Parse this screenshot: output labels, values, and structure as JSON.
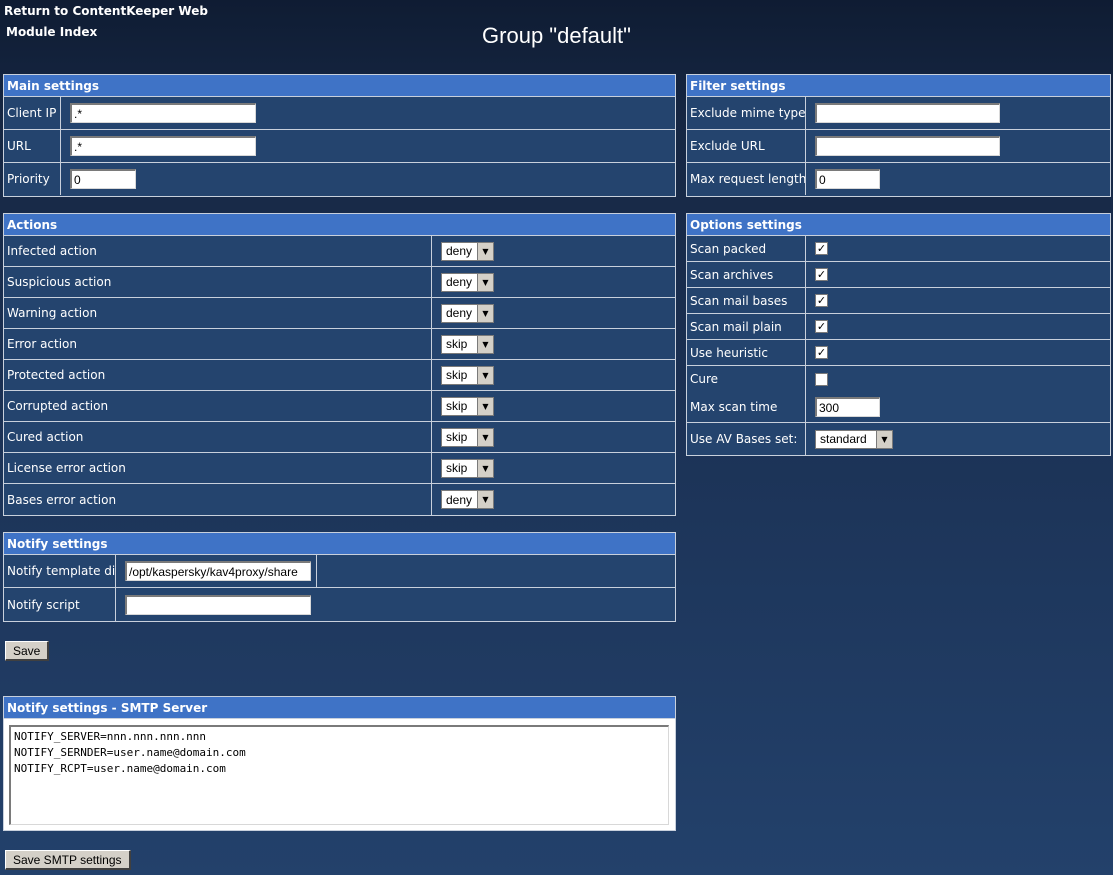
{
  "nav": {
    "return_link": "Return to ContentKeeper Web",
    "module_index": "Module Index"
  },
  "page_title": "Group \"default\"",
  "main_settings": {
    "title": "Main settings",
    "client_ip_label": "Client IP",
    "client_ip_value": ".*",
    "url_label": "URL",
    "url_value": ".*",
    "priority_label": "Priority",
    "priority_value": "0"
  },
  "filter_settings": {
    "title": "Filter settings",
    "exclude_mime_label": "Exclude mime type",
    "exclude_mime_value": "",
    "exclude_url_label": "Exclude URL",
    "exclude_url_value": "",
    "max_request_label": "Max request length",
    "max_request_value": "0"
  },
  "actions": {
    "title": "Actions",
    "items": [
      {
        "label": "Infected action",
        "value": "deny"
      },
      {
        "label": "Suspicious action",
        "value": "deny"
      },
      {
        "label": "Warning action",
        "value": "deny"
      },
      {
        "label": "Error action",
        "value": "skip"
      },
      {
        "label": "Protected action",
        "value": "skip"
      },
      {
        "label": "Corrupted action",
        "value": "skip"
      },
      {
        "label": "Cured action",
        "value": "skip"
      },
      {
        "label": "License error action",
        "value": "skip"
      },
      {
        "label": "Bases error action",
        "value": "deny"
      }
    ]
  },
  "options_settings": {
    "title": "Options settings",
    "checks": [
      {
        "label": "Scan packed",
        "checked": true
      },
      {
        "label": "Scan archives",
        "checked": true
      },
      {
        "label": "Scan mail bases",
        "checked": true
      },
      {
        "label": "Scan mail plain",
        "checked": true
      },
      {
        "label": "Use heuristic",
        "checked": true
      },
      {
        "label": "Cure",
        "checked": false
      }
    ],
    "max_scan_time_label": "Max scan time",
    "max_scan_time_value": "300",
    "av_bases_label": "Use AV Bases set:",
    "av_bases_value": "standard"
  },
  "notify_settings": {
    "title": "Notify settings",
    "template_dir_label": "Notify template dir",
    "template_dir_value": "/opt/kaspersky/kav4proxy/share",
    "script_label": "Notify script",
    "script_value": ""
  },
  "save_button": "Save",
  "smtp": {
    "title": "Notify settings - SMTP Server",
    "text": "NOTIFY_SERVER=nnn.nnn.nnn.nnn\nNOTIFY_SERNDER=user.name@domain.com\nNOTIFY_RCPT=user.name@domain.com",
    "save_button": "Save SMTP settings"
  }
}
